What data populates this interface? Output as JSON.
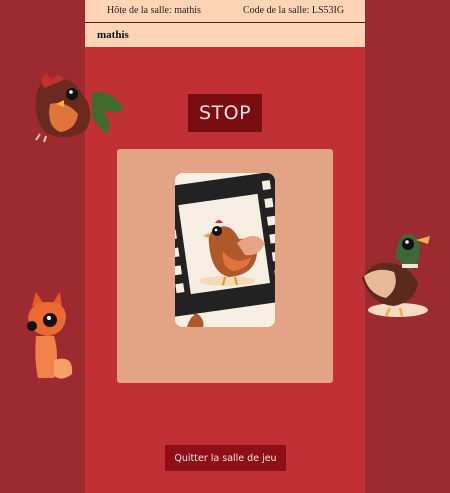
{
  "header": {
    "host_label": "Hôte de la salle: mathis",
    "code_label": "Code de la salle: LS53IG"
  },
  "player": {
    "name": "mathis"
  },
  "game": {
    "stop_label": "STOP",
    "card_icon": "chicken-film-card",
    "quit_label": "Quitter la salle de jeu"
  },
  "decorations": [
    "rooster-icon",
    "duck-icon",
    "fox-icon"
  ],
  "colors": {
    "page_bg": "#9c2a30",
    "column_bg": "#c03035",
    "header_bg": "#fdd5b6",
    "stop_bg": "#7a0d12",
    "board_bg": "#e2a485",
    "quit_bg": "#8e0f15"
  }
}
